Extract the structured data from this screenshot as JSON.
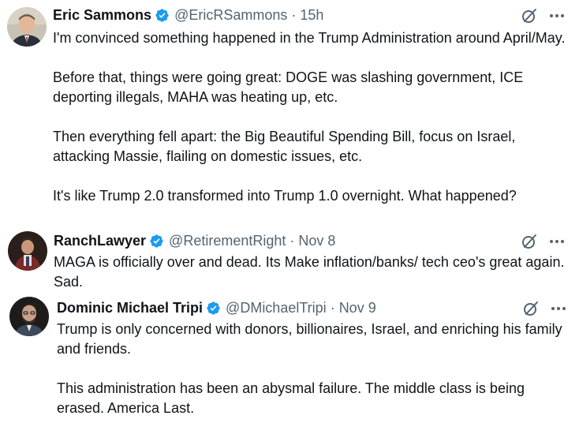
{
  "tweets": [
    {
      "name": "Eric Sammons",
      "handle": "@EricRSammons",
      "separator": "·",
      "time": "15h",
      "paragraphs": [
        "I'm convinced something happened in the Trump Administration around April/May.",
        "Before that, things were going great: DOGE was slashing government, ICE deporting illegals, MAHA was heating up, etc.",
        "Then everything fell apart: the Big Beautiful Spending Bill, focus on Israel, attacking Massie, flailing on domestic issues, etc.",
        "It's like Trump 2.0 transformed into Trump 1.0 overnight. What happened?"
      ]
    },
    {
      "name": "RanchLawyer",
      "handle": "@RetirementRight",
      "separator": "·",
      "time": "Nov 8",
      "paragraphs": [
        "MAGA is officially over and dead. Its Make inflation/banks/ tech ceo's great again. Sad."
      ]
    },
    {
      "name": "Dominic Michael Tripi",
      "handle": "@DMichaelTripi",
      "separator": "·",
      "time": "Nov 9",
      "paragraphs": [
        "Trump is only concerned with donors, billionaires, Israel, and enriching his family and friends.",
        "This administration has been an abysmal failure. The middle class is being erased. America Last."
      ]
    }
  ],
  "colors": {
    "verified_badge": "#1d9bf0",
    "secondary_text": "#536471",
    "primary_text": "#0f1419"
  },
  "icons": {
    "verified": "verified-badge-icon",
    "grok": "grok-icon",
    "more": "more-icon"
  }
}
